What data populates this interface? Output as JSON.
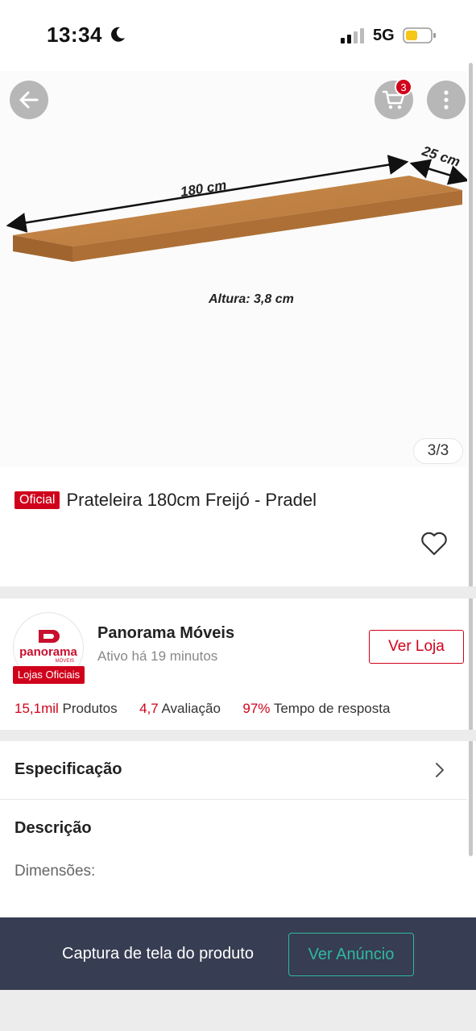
{
  "status_bar": {
    "time": "13:34",
    "network": "5G"
  },
  "header": {
    "cart_count": "3"
  },
  "gallery": {
    "length_label": "180 cm",
    "depth_label": "25 cm",
    "height_label": "Altura: 3,8 cm",
    "counter": "3/3"
  },
  "product": {
    "badge": "Oficial",
    "title": "Prateleira 180cm Freijó - Pradel"
  },
  "store": {
    "logo_text": "panorama",
    "logo_subtext": "MÓVEIS",
    "official_badge": "Lojas Oficiais",
    "name": "Panorama Móveis",
    "active": "Ativo há 19 minutos",
    "visit_button": "Ver Loja",
    "stats": [
      {
        "value": "15,1mil",
        "label": "Produtos"
      },
      {
        "value": "4,7",
        "label": "Avaliação"
      },
      {
        "value": "97%",
        "label": "Tempo de resposta"
      }
    ]
  },
  "sections": {
    "specification": "Especificação",
    "description": "Descrição",
    "dimensions": "Dimensões:"
  },
  "bottom_bar": {
    "caption": "Captura de tela do produto",
    "button": "Ver Anúncio"
  },
  "colors": {
    "accent_red": "#d0021b",
    "teal": "#2fb8a3",
    "bottom_bar": "#373d52"
  }
}
